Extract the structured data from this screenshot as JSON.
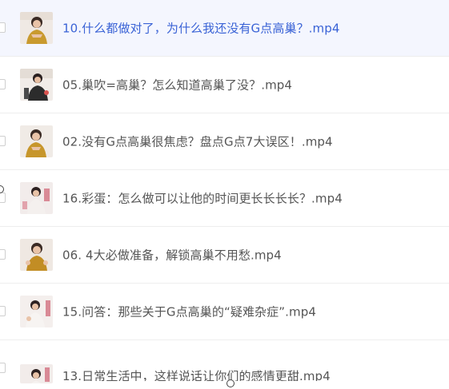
{
  "files": [
    {
      "name": "10.什么都做对了，为什么我还没有G点高巢？.mp4",
      "selected": true,
      "thumb_icon": "video-thumbnail-icon"
    },
    {
      "name": "05.巢吹=高巢？怎么知道高巢了没？.mp4",
      "selected": false,
      "thumb_icon": "video-thumbnail-icon"
    },
    {
      "name": "02.没有G点高巢很焦虑？盘点G点7大误区！.mp4",
      "selected": false,
      "thumb_icon": "video-thumbnail-icon"
    },
    {
      "name": "16.彩蛋：怎么做可以让他的时间更长长长长？.mp4",
      "selected": false,
      "thumb_icon": "video-thumbnail-icon"
    },
    {
      "name": "06. 4大必做准备，解锁高巢不用愁.mp4",
      "selected": false,
      "thumb_icon": "video-thumbnail-icon"
    },
    {
      "name": "15.问答：那些关于G点高巢的“疑难杂症”.mp4",
      "selected": false,
      "thumb_icon": "video-thumbnail-icon"
    },
    {
      "name": "13.日常生活中，这样说话让你们的感情更甜.mp4",
      "selected": false,
      "thumb_icon": "video-thumbnail-icon"
    }
  ],
  "colors": {
    "selected_text": "#3a63d6",
    "normal_text": "#555555",
    "selected_bg": "#f4f6fe",
    "divider": "#eeeeee"
  }
}
